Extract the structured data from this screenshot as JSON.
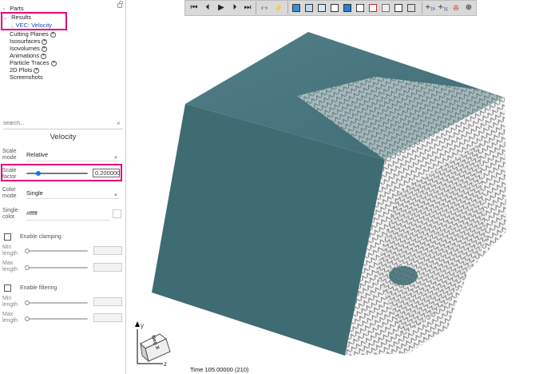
{
  "tree": {
    "parts": "Parts",
    "results": "Results",
    "vec_velocity": "VEC: Velocity",
    "cutting_planes": "Cutting Planes",
    "isosurfaces": "Isosurfaces",
    "isovolumes": "Isovolumes",
    "animations": "Animations",
    "particle_traces": "Particle Traces",
    "plots_2d": "2D Plots",
    "screenshots": "Screenshots",
    "plus_glyph": "+"
  },
  "search": {
    "placeholder": "search...",
    "clear_glyph": "×"
  },
  "panel": {
    "title": "Velocity",
    "scale_mode_label": "Scale mode",
    "scale_mode_value": "Relative",
    "scale_factor_label": "Scale factor",
    "scale_factor_value": "0.200000",
    "scale_factor_slider": 0.2,
    "color_mode_label": "Color mode",
    "color_mode_value": "Single",
    "single_color_label": "Single color",
    "single_color_value": "#ffffff",
    "enable_clamping": "Enable clamping",
    "clamp_min_label": "Min length",
    "clamp_max_label": "Max length",
    "enable_filtering": "Enable filtering",
    "filter_min_label": "Min length",
    "filter_max_label": "Max length"
  },
  "toolbar": {
    "first": "⏮",
    "prev": "⏴",
    "play": "▶",
    "next": "⏵",
    "last": "⏭",
    "view_tp": "TP",
    "view_te": "TE"
  },
  "axes": {
    "y": "y",
    "z": "z",
    "cube_label": "Neg X"
  },
  "status": {
    "time": "Time 105.00000 (210)"
  },
  "colors": {
    "accent": "#e6007e",
    "cube": "#3f6b73",
    "cube_top": "#4b7880",
    "slider_blue": "#1a73e8"
  }
}
